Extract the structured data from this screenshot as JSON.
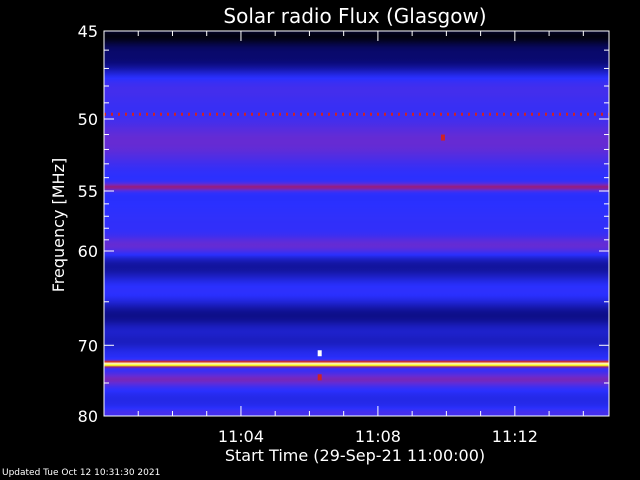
{
  "chart_data": {
    "type": "heatmap",
    "title": "Solar radio Flux (Glasgow)",
    "ylabel": "Frequency [MHz]",
    "xlabel": "Start Time (29-Sep-21 11:00:00)",
    "y_scale": "reciprocal",
    "ylim": [
      45,
      80
    ],
    "y_ticks_major": [
      45,
      50,
      55,
      60,
      70,
      80
    ],
    "y_ticks_minor": [
      46,
      47,
      48,
      49,
      51,
      52,
      53,
      54,
      56,
      57,
      58,
      59,
      65,
      75
    ],
    "x_ticks": [
      {
        "minute": 4,
        "label": "11:04"
      },
      {
        "minute": 8,
        "label": "11:08"
      },
      {
        "minute": 12,
        "label": "11:12"
      }
    ],
    "x_range_minutes": [
      0,
      14.75
    ],
    "colormap": [
      "#000000",
      "#0a0a7a",
      "#2a30ff",
      "#6a2bd0",
      "#c01030",
      "#ff7000",
      "#ffff00",
      "#ffffff"
    ],
    "bands": [
      {
        "freq": 45.2,
        "width": 0.6,
        "intensity": 0.05
      },
      {
        "freq": 46.5,
        "width": 1.0,
        "intensity": 0.12
      },
      {
        "freq": 48.0,
        "width": 1.2,
        "intensity": 0.35
      },
      {
        "freq": 49.7,
        "width": 0.12,
        "intensity": 0.6,
        "dotted": true
      },
      {
        "freq": 51.5,
        "width": 1.5,
        "intensity": 0.42
      },
      {
        "freq": 54.7,
        "width": 0.3,
        "intensity": 0.5
      },
      {
        "freq": 57.5,
        "width": 1.3,
        "intensity": 0.3
      },
      {
        "freq": 59.5,
        "width": 0.8,
        "intensity": 0.42
      },
      {
        "freq": 61.5,
        "width": 1.2,
        "intensity": 0.18
      },
      {
        "freq": 64.0,
        "width": 1.0,
        "intensity": 0.3
      },
      {
        "freq": 66.5,
        "width": 1.5,
        "intensity": 0.16
      },
      {
        "freq": 69.5,
        "width": 1.2,
        "intensity": 0.22
      },
      {
        "freq": 72.4,
        "width": 0.35,
        "intensity": 1.0
      },
      {
        "freq": 74.5,
        "width": 1.0,
        "intensity": 0.45
      },
      {
        "freq": 77.5,
        "width": 1.2,
        "intensity": 0.26
      },
      {
        "freq": 79.5,
        "width": 0.6,
        "intensity": 0.35
      }
    ],
    "events": [
      {
        "minute": 6.3,
        "freq": 71.0,
        "intensity": 1.0
      },
      {
        "minute": 9.9,
        "freq": 51.2,
        "intensity": 0.6
      },
      {
        "minute": 6.3,
        "freq": 74.2,
        "intensity": 0.6
      }
    ]
  },
  "footer": "Updated Tue Oct 12 10:31:30 2021"
}
